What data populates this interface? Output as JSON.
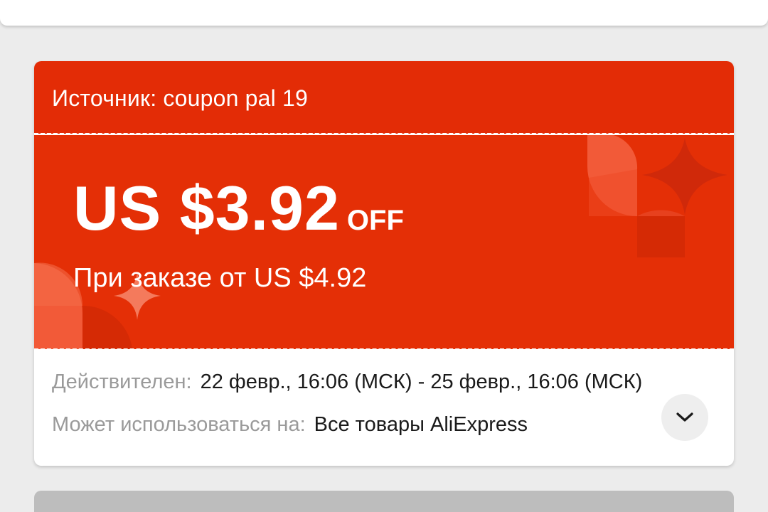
{
  "coupon": {
    "source_text": "Источник: coupon pal 19",
    "amount": "US $3.92",
    "off_label": "OFF",
    "min_order": "При заказе от US $4.92",
    "valid_label": "Действителен:",
    "valid_value": "22 февр., 16:06 (МСК) - 25 февр., 16:06 (МСК)",
    "usable_label": "Может использоваться на:",
    "usable_value": "Все товары AliExpress",
    "expand_icon": "chevron-down-icon"
  },
  "colors": {
    "background": "#ececec",
    "coupon_red": "#e42f06",
    "card_white": "#ffffff",
    "label_gray": "#9a9a9a",
    "text_dark": "#1a1a1a"
  }
}
